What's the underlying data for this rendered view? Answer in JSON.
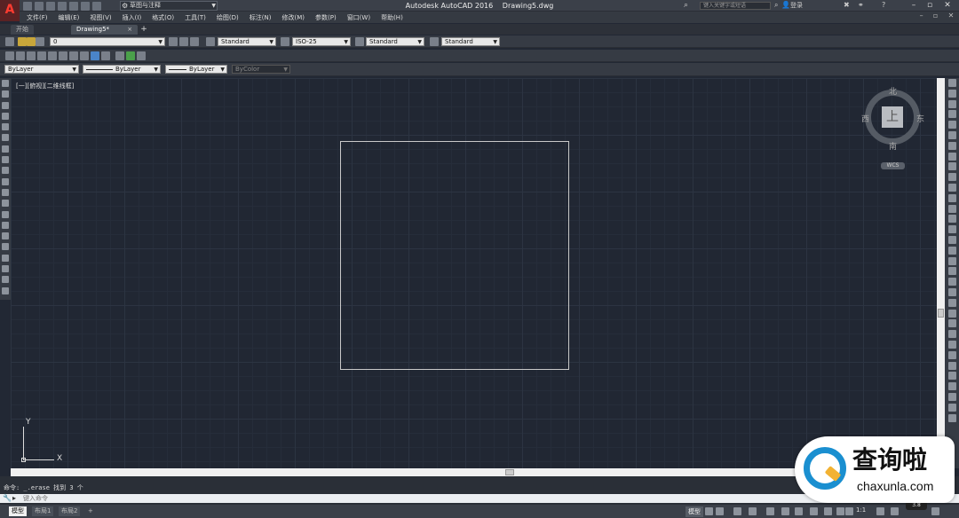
{
  "titlebar": {
    "app_name": "Autodesk AutoCAD 2016",
    "file_name": "Drawing5.dwg",
    "workspace": "草图与注释",
    "search_placeholder": "键入关键字或短语",
    "login": "登录",
    "help": "?",
    "logo_letter": "A"
  },
  "menubar": {
    "items": [
      "文件(F)",
      "编辑(E)",
      "视图(V)",
      "插入(I)",
      "格式(O)",
      "工具(T)",
      "绘图(D)",
      "标注(N)",
      "修改(M)",
      "参数(P)",
      "窗口(W)",
      "帮助(H)"
    ]
  },
  "tabs": {
    "start": "开始",
    "drawing": "Drawing5*",
    "close": "×",
    "add": "+"
  },
  "toolbar": {
    "layer_value": "0",
    "text_style": "Standard",
    "dim_style": "ISO-25",
    "table_style": "Standard",
    "multileader_style": "Standard",
    "color": "ByLayer",
    "linetype": "ByLayer",
    "lineweight": "ByLayer",
    "plotstyle": "ByColor"
  },
  "canvas": {
    "viewport_label": "[一][俯视][二维线框]",
    "viewcube": {
      "top_face": "上",
      "north": "北",
      "south": "南",
      "east": "东",
      "west": "西",
      "wcs": "WCS"
    },
    "ucs": {
      "x_label": "X",
      "y_label": "Y"
    }
  },
  "command": {
    "history": "命令: _.erase 找到 3 个",
    "input_placeholder": "键入命令"
  },
  "statusbar": {
    "layout_tabs": [
      "模型",
      "布局1",
      "布局2"
    ],
    "add_tab": "+",
    "model": "模型",
    "scale": "1:1",
    "perf": "3.8"
  },
  "watermark": {
    "cn": "查询啦",
    "en": "chaxunla.com"
  }
}
